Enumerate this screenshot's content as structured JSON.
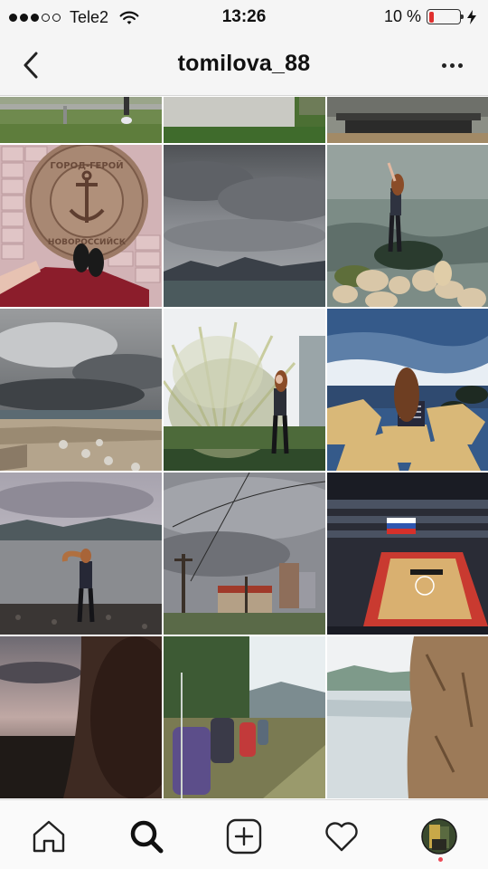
{
  "status_bar": {
    "carrier": "Tele2",
    "signal_bars_filled": 3,
    "signal_bars_total": 5,
    "time": "13:26",
    "battery_text": "10 %",
    "battery_level": 0.1,
    "battery_color": "#e0302f",
    "icons": [
      "signal-dots-icon",
      "wifi-icon",
      "battery-icon",
      "charging-icon"
    ]
  },
  "nav": {
    "title": "tomilova_88",
    "back_icon": "chevron-left-icon",
    "more_icon": "more-horizontal-icon"
  },
  "grid": {
    "columns": 3,
    "photos": [
      {
        "name": "photo-top-partial-1",
        "desc": "grass and railing"
      },
      {
        "name": "photo-top-partial-2",
        "desc": "concrete block on grass"
      },
      {
        "name": "photo-top-partial-3",
        "desc": "bench with people"
      },
      {
        "name": "photo-manhole-cover",
        "desc": "Novorossiysk manhole cover"
      },
      {
        "name": "photo-stormy-sky-sea",
        "desc": "clouds over bay"
      },
      {
        "name": "photo-girl-on-rock",
        "desc": "girl on rocks at sea"
      },
      {
        "name": "photo-embankment-clouds",
        "desc": "embankment under clouds"
      },
      {
        "name": "photo-pampas-grass",
        "desc": "girl by pampas grass"
      },
      {
        "name": "photo-girl-sitting-rocks",
        "desc": "girl sitting on rocks"
      },
      {
        "name": "photo-girl-on-beach",
        "desc": "girl on pebble beach"
      },
      {
        "name": "photo-power-lines",
        "desc": "power lines and buildings"
      },
      {
        "name": "photo-basketball-arena",
        "desc": "arena with flag"
      },
      {
        "name": "photo-dark-selfie",
        "desc": "dark selfie at dusk"
      },
      {
        "name": "photo-hikers",
        "desc": "hikers with backpacks"
      },
      {
        "name": "photo-lake-cliff",
        "desc": "lake and cliff"
      }
    ]
  },
  "tab_bar": {
    "tabs": [
      {
        "name": "tab-home",
        "icon": "home-icon"
      },
      {
        "name": "tab-search",
        "icon": "search-icon",
        "active": true
      },
      {
        "name": "tab-new-post",
        "icon": "plus-square-icon"
      },
      {
        "name": "tab-activity",
        "icon": "heart-icon"
      },
      {
        "name": "tab-profile",
        "icon": "profile-avatar"
      }
    ],
    "notification_color": "#ed4956"
  }
}
